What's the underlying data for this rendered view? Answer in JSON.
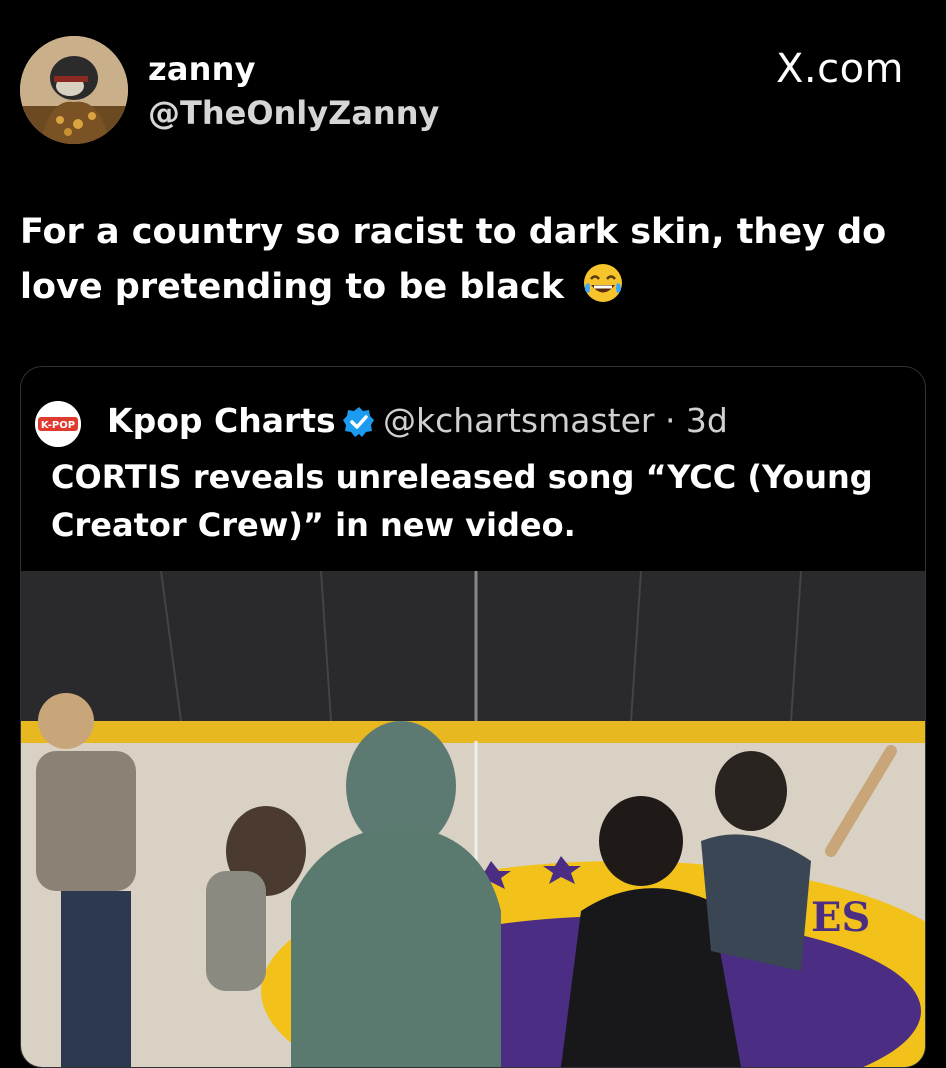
{
  "author": {
    "name": "zanny",
    "handle": "@TheOnlyZanny"
  },
  "brand": {
    "label": "X.com"
  },
  "tweet": {
    "text": "For a country so racist to dark skin, they do love pretending to be black",
    "emoji_icon": "face-with-tears-of-joy-icon"
  },
  "quote": {
    "logo_text": "K-POP",
    "name": "Kpop Charts",
    "verified_icon": "verified-badge-icon",
    "handle_time": "@kchartsmaster · 3d",
    "text": "CORTIS reveals unreleased song “YCC (Young Creator Crew)” in new video.",
    "media_text": "ES"
  },
  "colors": {
    "background": "#000000",
    "text": "#ffffff",
    "muted": "#d6d6d6",
    "border": "#2f3336",
    "verified": "#1d9bf0",
    "court_yellow": "#f2c21a",
    "court_purple": "#4b2e83"
  }
}
